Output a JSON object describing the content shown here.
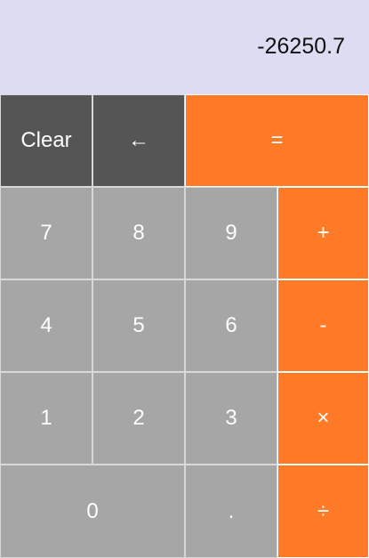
{
  "display": {
    "value": "-26250.7"
  },
  "keys": {
    "clear": "Clear",
    "backspace": "←",
    "equals": "=",
    "seven": "7",
    "eight": "8",
    "nine": "9",
    "plus": "+",
    "four": "4",
    "five": "5",
    "six": "6",
    "minus": "-",
    "one": "1",
    "two": "2",
    "three": "3",
    "multiply": "×",
    "zero": "0",
    "decimal": ".",
    "divide": "÷"
  },
  "colors": {
    "display_bg": "#dcdcf2",
    "function_key": "#555555",
    "digit_key": "#a6a6a6",
    "operator_key": "#ff7a26"
  }
}
